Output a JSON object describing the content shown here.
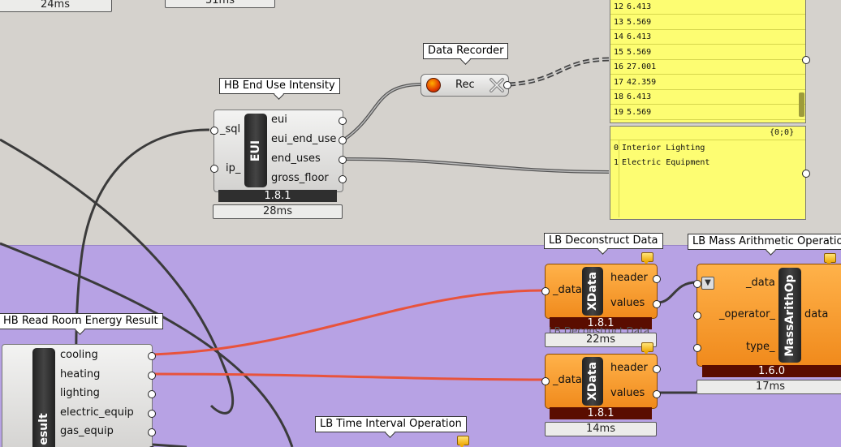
{
  "timings": {
    "top_left": "24ms",
    "top_mid": "31ms",
    "hb_eui": "28ms",
    "xdata1": "22ms",
    "xdata2": "14ms",
    "massarith": "17ms"
  },
  "hb_eui": {
    "title": "HB End Use Intensity",
    "badge": "EUI",
    "inputs": [
      "_sql",
      "ip_"
    ],
    "outputs": [
      "eui",
      "eui_end_use",
      "end_uses",
      "gross_floor"
    ],
    "version": "1.8.1"
  },
  "data_recorder": {
    "title": "Data Recorder",
    "label": "Rec"
  },
  "panel_values": {
    "rows": [
      {
        "i": "12",
        "v": "6.413"
      },
      {
        "i": "13",
        "v": "5.569"
      },
      {
        "i": "14",
        "v": "6.413"
      },
      {
        "i": "15",
        "v": "5.569"
      },
      {
        "i": "16",
        "v": "27.001"
      },
      {
        "i": "17",
        "v": "42.359"
      },
      {
        "i": "18",
        "v": "6.413"
      },
      {
        "i": "19",
        "v": "5.569"
      }
    ]
  },
  "panel_enduses": {
    "path": "{0;0}",
    "rows": [
      {
        "i": "0",
        "v": "Interior Lighting"
      },
      {
        "i": "1",
        "v": "Electric Equipment"
      }
    ]
  },
  "xdata1": {
    "title": "LB Deconstruct Data",
    "badge": "XData",
    "input": "_data",
    "outputs": [
      "header",
      "values"
    ],
    "version": "1.8.1",
    "ghost_text": "LB Deconstruct Data"
  },
  "xdata2": {
    "badge": "XData",
    "input": "_data",
    "outputs": [
      "header",
      "values"
    ],
    "version": "1.8.1"
  },
  "massarith": {
    "title": "LB Mass Arithmetic Operation",
    "badge": "MassArithOp",
    "inputs": [
      "_data",
      "_operator_",
      "type_"
    ],
    "output": "data",
    "version": "1.6.0"
  },
  "hb_read": {
    "title": "HB Read Room Energy Result",
    "badge": "esult",
    "outputs": [
      "cooling",
      "heating",
      "lighting",
      "electric_equip",
      "gas_equip"
    ]
  },
  "lb_time": {
    "title": "LB Time Interval Operation"
  },
  "colors": {
    "canvas": "#d5d2cd",
    "group": "#b7a2e4",
    "component_orange": "#f39a2a",
    "panel_yellow": "#fdfd72",
    "wire_red": "#e8533c",
    "wire_dark": "#3b3b3b"
  }
}
